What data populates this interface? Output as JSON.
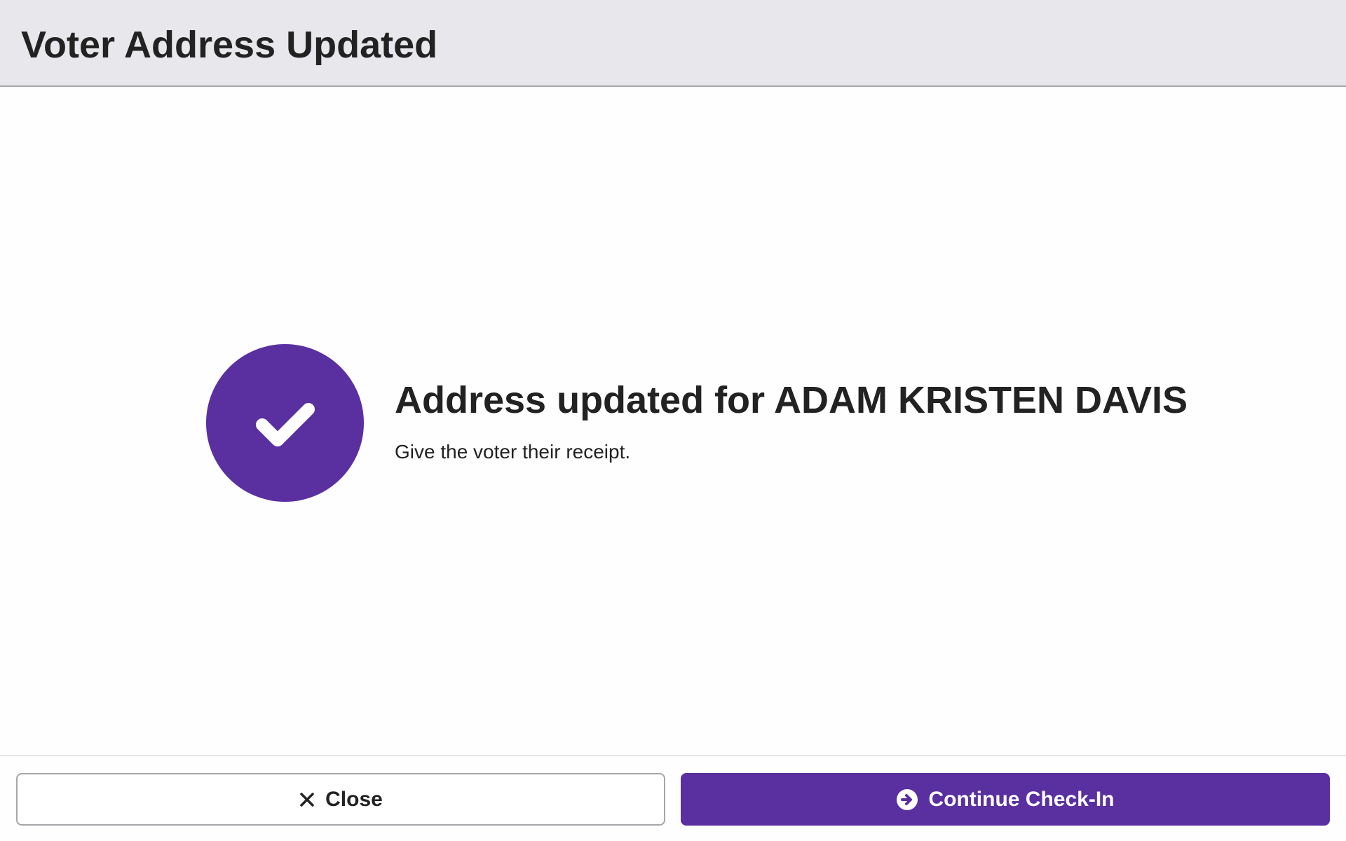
{
  "header": {
    "title": "Voter Address Updated"
  },
  "main": {
    "icon": "check-circle-icon",
    "heading": "Address updated for ADAM KRISTEN DAVIS",
    "subtext": "Give the voter their receipt."
  },
  "footer": {
    "close_label": "Close",
    "close_icon": "close-icon",
    "continue_label": "Continue Check-In",
    "continue_icon": "arrow-right-circle-icon"
  },
  "colors": {
    "accent": "#5a2fa0",
    "header_bg": "#e8e8ec",
    "text": "#222222"
  }
}
